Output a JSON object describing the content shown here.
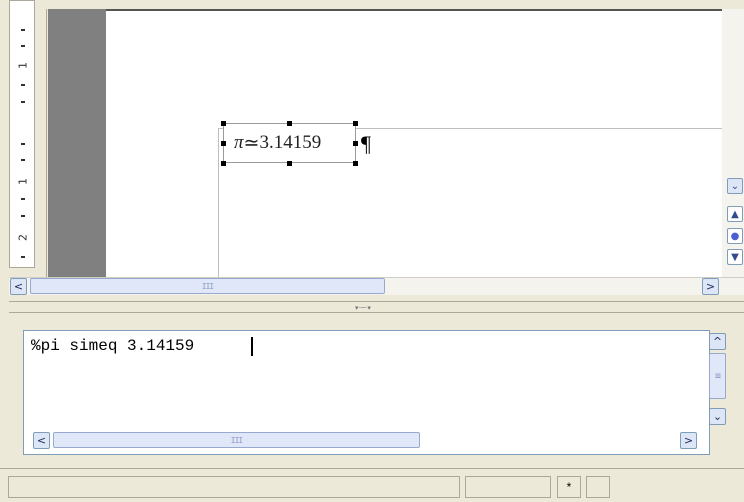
{
  "ruler": {
    "labels": [
      "1",
      "1",
      "2"
    ]
  },
  "formula": {
    "symbol": "π",
    "relation": "≃",
    "value": "3.14159"
  },
  "paragraph_mark": "¶",
  "document_scroll": {
    "nav_up": "▲",
    "nav_select": "●",
    "nav_down": "▼",
    "scroll_down": "⌄",
    "left": "<",
    "right": ">",
    "grip": "III"
  },
  "splitter": {
    "grip": "▾ ······ ▾"
  },
  "command": {
    "text": "%pi simeq 3.14159",
    "scroll_up": "^",
    "scroll_down": "⌄",
    "grip": "≡",
    "left": "<",
    "right": ">",
    "hgrip": "III"
  },
  "statusbar": {
    "modified_indicator": "*"
  }
}
